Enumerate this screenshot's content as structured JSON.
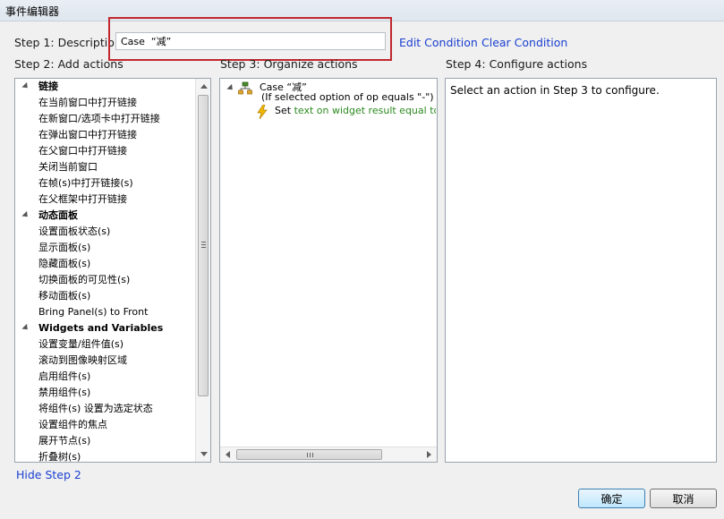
{
  "window": {
    "title": "事件编辑器"
  },
  "step1": {
    "label": "Step 1: Description",
    "description_value": "Case  “减”",
    "edit_condition": "Edit Condition",
    "clear_condition": "Clear Condition"
  },
  "step2": {
    "label": "Step 2: Add actions",
    "hide_link": "Hide Step 2",
    "groups": [
      {
        "label": "链接",
        "items": [
          "在当前窗口中打开链接",
          "在新窗口/选项卡中打开链接",
          "在弹出窗口中打开链接",
          "在父窗口中打开链接",
          "关闭当前窗口",
          "在帧(s)中打开链接(s)",
          "在父框架中打开链接"
        ]
      },
      {
        "label": "动态面板",
        "items": [
          "设置面板状态(s)",
          "显示面板(s)",
          "隐藏面板(s)",
          "切换面板的可见性(s)",
          "移动面板(s)",
          "Bring Panel(s) to Front"
        ]
      },
      {
        "label": "Widgets and Variables",
        "items": [
          "设置变量/组件值(s)",
          "滚动到图像映射区域",
          "启用组件(s)",
          "禁用组件(s)",
          "将组件(s) 设置为选定状态",
          "设置组件的焦点",
          "展开节点(s)",
          "折叠树(s)"
        ]
      }
    ]
  },
  "step3": {
    "label": "Step 3: Organize actions",
    "case_title": "Case  “减”",
    "case_condition": "(If selected option of op equals \"-\")",
    "action_prefix": "Set ",
    "action_text": "text on widget result equal to \""
  },
  "step4": {
    "label": "Step 4: Configure actions",
    "hint": "Select an action in Step 3 to configure."
  },
  "footer": {
    "ok": "确定",
    "cancel": "取消"
  },
  "colors": {
    "link": "#1a3fd1",
    "highlight": "#c0282e",
    "action_green": "#2b8a1f"
  }
}
